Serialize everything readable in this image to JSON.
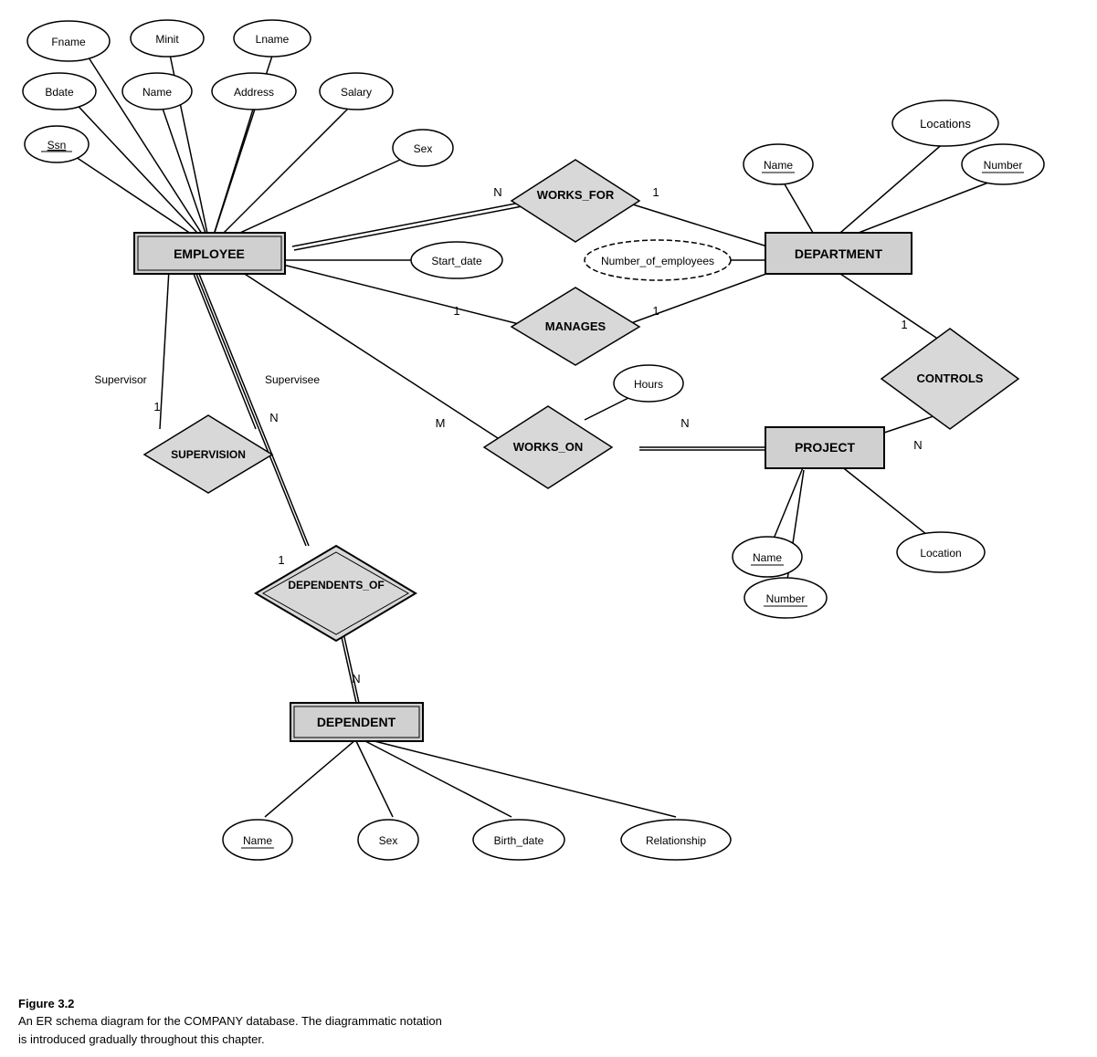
{
  "caption": {
    "title": "Figure 3.2",
    "line1": "An ER schema diagram for the COMPANY database. The diagrammatic notation",
    "line2": "is introduced gradually throughout this chapter."
  }
}
